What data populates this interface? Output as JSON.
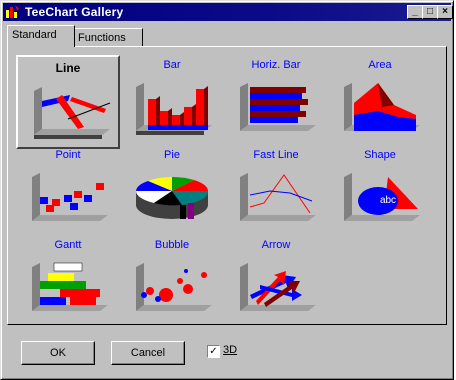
{
  "window": {
    "title": "TeeChart Gallery",
    "buttons": {
      "minimize": "_",
      "maximize": "□",
      "close": "×"
    }
  },
  "tabs": [
    {
      "label": "Standard",
      "active": true
    },
    {
      "label": "Functions",
      "active": false
    }
  ],
  "gallery": [
    {
      "label": "Line",
      "selected": true
    },
    {
      "label": "Bar",
      "selected": false
    },
    {
      "label": "Horiz. Bar",
      "selected": false
    },
    {
      "label": "Area",
      "selected": false
    },
    {
      "label": "Point",
      "selected": false
    },
    {
      "label": "Pie",
      "selected": false
    },
    {
      "label": "Fast Line",
      "selected": false
    },
    {
      "label": "Shape",
      "selected": false
    },
    {
      "label": "Gantt",
      "selected": false
    },
    {
      "label": "Bubble",
      "selected": false
    },
    {
      "label": "Arrow",
      "selected": false
    }
  ],
  "shape_text": "abc",
  "footer": {
    "ok_label": "OK",
    "cancel_label": "Cancel",
    "checkbox_label": "3D",
    "checkbox_checked": true,
    "checkbox_mark": "✓"
  },
  "colors": {
    "titlebar": "#000080",
    "face": "#c0c0c0",
    "link": "#0000ff",
    "series_red": "#ff0000",
    "series_blue": "#0000ff"
  }
}
